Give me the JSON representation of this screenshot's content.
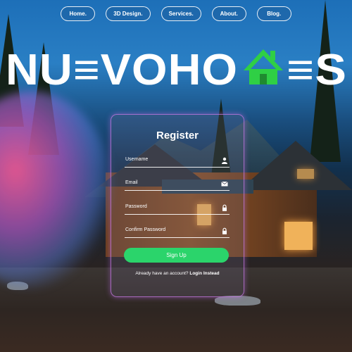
{
  "nav": {
    "items": [
      {
        "label": "Home."
      },
      {
        "label": "3D Design."
      },
      {
        "label": "Services."
      },
      {
        "label": "About."
      },
      {
        "label": "Blog."
      }
    ]
  },
  "logo": {
    "text_before": "NU≡VOHO",
    "text_after": "≡S",
    "icon": "house-icon",
    "accent_color": "#2fcf45"
  },
  "register": {
    "title": "Register",
    "fields": [
      {
        "label": "Username",
        "icon": "user-icon"
      },
      {
        "label": "Email",
        "icon": "envelope-icon"
      },
      {
        "label": "Password",
        "icon": "lock-icon"
      },
      {
        "label": "Confirm Password",
        "icon": "lock-icon"
      }
    ],
    "submit_label": "Sign Up",
    "submit_color": "#2bd46b",
    "login_prompt": "Already have an account?",
    "login_link": "Login Instead"
  }
}
